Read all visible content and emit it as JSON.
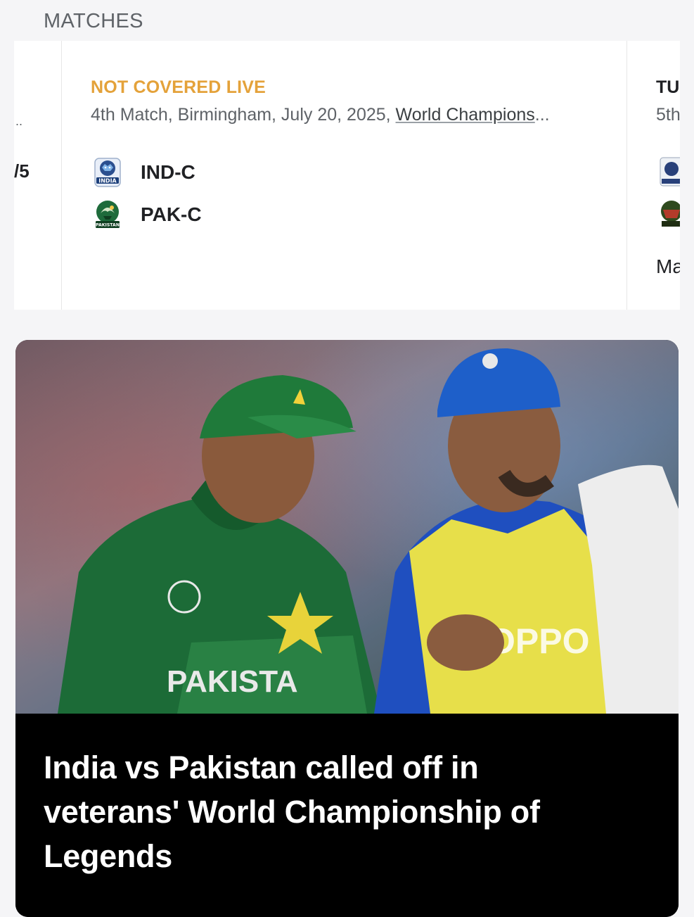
{
  "section": {
    "title": "MATCHES"
  },
  "carousel": {
    "previous_card": {
      "meta_fragment": "..",
      "score_fragment": "/5"
    },
    "current_card": {
      "status": "NOT COVERED LIVE",
      "meta_prefix": "4th Match, Birmingham, July 20, 2025, ",
      "series_link": "World Champions",
      "ellipsis": "...",
      "teams": [
        {
          "name": "IND-C",
          "logo_label": "INDIA",
          "logo": "india-champions-logo"
        },
        {
          "name": "PAK-C",
          "logo_label": "PAKISTAN",
          "logo": "pakistan-champions-logo"
        }
      ]
    },
    "next_card": {
      "status_fragment": "TU",
      "meta_fragment": "5th",
      "footer_fragment": "Ma"
    }
  },
  "news": {
    "headline": "India vs Pakistan called off in veterans' World Championship of Legends",
    "image": {
      "jersey_text": "PAKISTA",
      "sponsor_text": "OPPO",
      "cap_color_left": "#1f7a3a",
      "cap_color_right": "#1e5fc9"
    }
  },
  "colors": {
    "status_accent": "#e4a23a",
    "headline_bg": "#000000",
    "page_bg": "#f5f5f7"
  }
}
